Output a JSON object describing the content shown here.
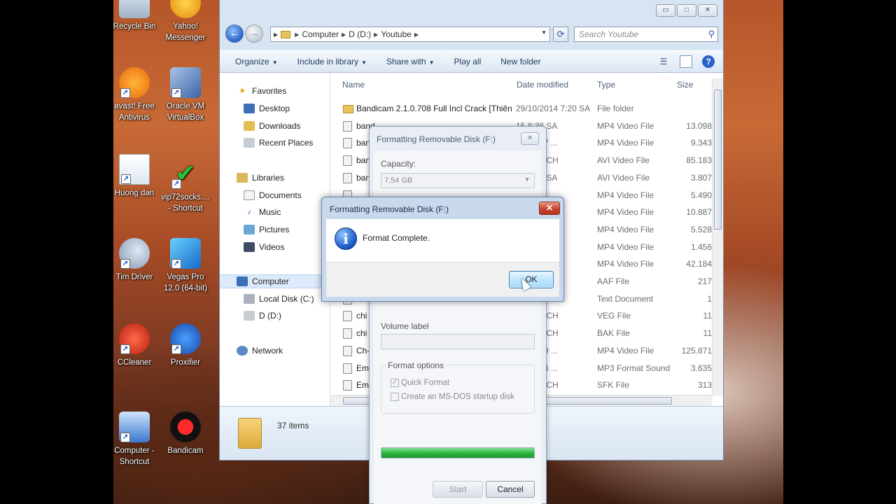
{
  "desktop": {
    "icons": [
      {
        "label": "Recycle Bin",
        "icon": "recycle-bin-icon"
      },
      {
        "label": "Yahoo!\nMessenger",
        "icon": "yahoo-messenger-icon"
      },
      {
        "label": "avast! Free\nAntivirus",
        "icon": "avast-icon"
      },
      {
        "label": "Oracle VM\nVirtualBox",
        "icon": "virtualbox-icon"
      },
      {
        "label": "Huong dan",
        "icon": "word-document-icon"
      },
      {
        "label": "vip72socks....\n- Shortcut",
        "icon": "checkmark-shortcut-icon"
      },
      {
        "label": "Tim Driver",
        "icon": "magnifier-icon"
      },
      {
        "label": "Vegas Pro\n12.0 (64-bit)",
        "icon": "vegas-pro-icon"
      },
      {
        "label": "CCleaner",
        "icon": "ccleaner-icon"
      },
      {
        "label": "Proxifier",
        "icon": "proxifier-icon"
      },
      {
        "label": "Computer -\nShortcut",
        "icon": "computer-icon"
      },
      {
        "label": "Bandicam",
        "icon": "bandicam-icon"
      }
    ]
  },
  "explorer": {
    "address": {
      "crumbs": [
        "Computer",
        "D (D:)",
        "Youtube"
      ]
    },
    "search_placeholder": "Search Youtube",
    "toolbar": {
      "organize": "Organize",
      "include": "Include in library",
      "share": "Share with",
      "play_all": "Play all",
      "new_folder": "New folder"
    },
    "nav": {
      "favorites": "Favorites",
      "desktop": "Desktop",
      "downloads": "Downloads",
      "recent": "Recent Places",
      "libraries": "Libraries",
      "documents": "Documents",
      "music": "Music",
      "pictures": "Pictures",
      "videos": "Videos",
      "computer": "Computer",
      "local_disk": "Local Disk (C:)",
      "d_drive": "D (D:)",
      "network": "Network"
    },
    "columns": {
      "name": "Name",
      "date": "Date modified",
      "type": "Type",
      "size": "Size"
    },
    "files": [
      {
        "name": "Bandicam 2.1.0.708 Full Incl Crack [Thiên ...",
        "date": "29/10/2014 7:20 SA",
        "type": "File folder",
        "size": "",
        "kind": "folder"
      },
      {
        "name": "band",
        "date": "15 8:38 SA",
        "type": "MP4 Video File",
        "size": "13.098",
        "kind": "file"
      },
      {
        "name": "band",
        "date": "15 12:37 ...",
        "type": "MP4 Video File",
        "size": "9.343",
        "kind": "file"
      },
      {
        "name": "band",
        "date": "15 2:48 CH",
        "type": "AVI Video File",
        "size": "85.183",
        "kind": "file"
      },
      {
        "name": "band",
        "date": "15 6:46 SA",
        "type": "AVI Video File",
        "size": "3.807",
        "kind": "file"
      },
      {
        "name": "",
        "date": "15 SA",
        "type": "MP4 Video File",
        "size": "5.490",
        "kind": "file"
      },
      {
        "name": "",
        "date": "CH",
        "type": "MP4 Video File",
        "size": "10.887",
        "kind": "file"
      },
      {
        "name": "",
        "date": "CH",
        "type": "MP4 Video File",
        "size": "5.528",
        "kind": "file"
      },
      {
        "name": "",
        "date": "SA",
        "type": "MP4 Video File",
        "size": "1.456",
        "kind": "file"
      },
      {
        "name": "",
        "date": "49 ...",
        "type": "MP4 Video File",
        "size": "42.184",
        "kind": "file"
      },
      {
        "name": "",
        "date": "3 CH",
        "type": "AAF File",
        "size": "217",
        "kind": "file"
      },
      {
        "name": "",
        "date": "3 CH",
        "type": "Text Document",
        "size": "1",
        "kind": "file"
      },
      {
        "name": "chi",
        "date": "15 9:12 CH",
        "type": "VEG File",
        "size": "11",
        "kind": "file"
      },
      {
        "name": "chi",
        "date": "15 9:12 CH",
        "type": "BAK File",
        "size": "11",
        "kind": "file"
      },
      {
        "name": "Ch-",
        "date": "15 12:49 ...",
        "type": "MP4 Video File",
        "size": "125.871",
        "kind": "file"
      },
      {
        "name": "Em",
        "date": "15 12:54 ...",
        "type": "MP3 Format Sound",
        "size": "3.635",
        "kind": "file"
      },
      {
        "name": "Em",
        "date": "15 9:17 CH",
        "type": "SFK File",
        "size": "313",
        "kind": "file"
      }
    ],
    "details": {
      "count": "37 items"
    }
  },
  "format_dialog": {
    "title": "Formatting Removable Disk (F:)",
    "capacity_label": "Capacity:",
    "capacity_value": "7,54 GB",
    "volume_label": "Volume label",
    "format_options": "Format options",
    "quick_format": "Quick Format",
    "msdos": "Create an MS-DOS startup disk",
    "progress": 1.0,
    "start": "Start",
    "cancel": "Cancel"
  },
  "message_box": {
    "title": "Formatting Removable Disk (F:)",
    "text": "Format Complete.",
    "ok": "OK"
  },
  "colors": {
    "accent": "#2a64c8",
    "progress": "#27b43c",
    "close_red": "#c9432c"
  }
}
